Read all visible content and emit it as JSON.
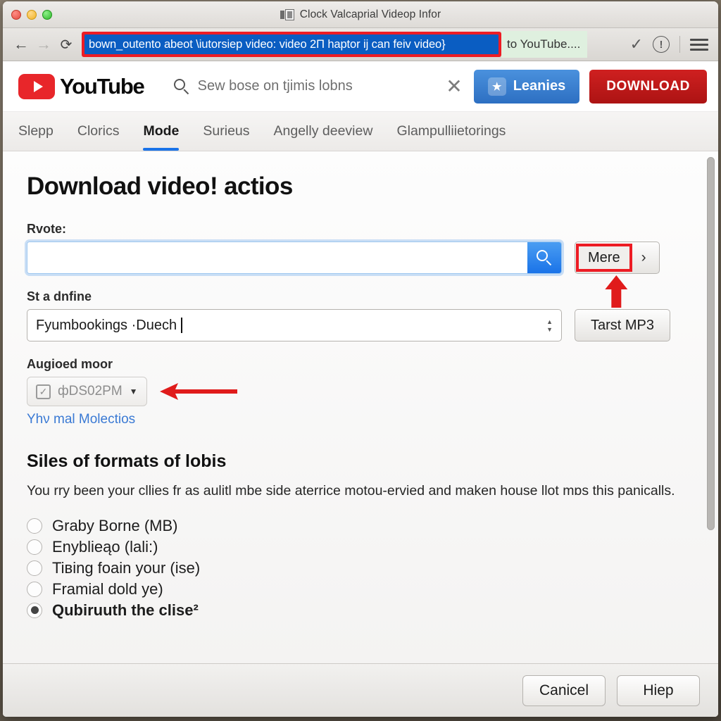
{
  "window": {
    "title": "Clock Valcaprial Videop Infor",
    "title_icon": "device-screen-icon",
    "traffic_lights": [
      "close-red",
      "minimize-yellow",
      "zoom-green"
    ]
  },
  "toolbar": {
    "back_icon": "back-arrow-icon",
    "forward_icon": "forward-arrow-icon",
    "reload_icon": "reload-icon",
    "url_value": "bown_outento abeot \\iutorsiep video: video 2П haptor ij can feiv video}",
    "url_tail": "to YouTube....",
    "check_icon": "checkmark-icon",
    "info_icon": "info-circle-icon",
    "menu_icon": "hamburger-menu-icon"
  },
  "site_header": {
    "logo_text": "YouTube",
    "logo_icon": "youtube-play-icon",
    "search_icon": "search-icon",
    "search_placeholder": "Sew bose on tјimis lobns",
    "search_value": "",
    "clear_icon": "close-x-icon",
    "blue_button": {
      "label": "Leanies",
      "icon": "shield-icon",
      "color": "#2d6fc2"
    },
    "red_button": {
      "label": "DOWNLOAD",
      "color": "#c01b1b"
    }
  },
  "tabs": [
    {
      "label": "Slepp",
      "active": false
    },
    {
      "label": "Clorics",
      "active": false
    },
    {
      "label": "Mode",
      "active": true
    },
    {
      "label": "Surieus",
      "active": false
    },
    {
      "label": "Angelly deeview",
      "active": false
    },
    {
      "label": "Glampulliietorings",
      "active": false
    }
  ],
  "main": {
    "heading": "Download video! actios",
    "url_label": "Rvote:",
    "url_input_value": "",
    "url_input_placeholder": "",
    "search_go_icon": "search-icon",
    "more_button": {
      "label": "Mere",
      "chevron": "›",
      "highlight_color": "#ed1c24"
    },
    "format_label": "St a dnfine",
    "format_value": "Fyumbookings ·Duech",
    "format_caret_icon": "sort-updown-icon",
    "mp3_button": "Tarst MP3",
    "audio_label": "Augioed moor",
    "audio_pill": {
      "label": "фDS02PM",
      "checkbox_icon": "checkbox-checked-icon",
      "caret_icon": "caret-down-icon"
    },
    "audio_link": "Yhν mal Molectios",
    "formats_heading": "Siles of formats of lobis",
    "formats_paragraph": "You rry been your cllies fr as aulitl mbe side aterrice motou-ervied and maken house llot mɒs this panicalls.",
    "radio_options": [
      {
        "label": "Graby Borne (MB)",
        "selected": false
      },
      {
        "label": "Enyblieąo (lali:)",
        "selected": false
      },
      {
        "label": "Tiвing foain your (ise)",
        "selected": false
      },
      {
        "label": "Framial dold ye)",
        "selected": false
      },
      {
        "label": "Qubiruuth the clise²",
        "selected": true
      }
    ]
  },
  "annotations": {
    "arrow_more": "red-arrow-up-icon",
    "arrow_audio": "red-arrow-left-icon",
    "highlight_color": "#ed1c24"
  },
  "footer": {
    "cancel_label": "Canicel",
    "help_label": "Hiep"
  }
}
